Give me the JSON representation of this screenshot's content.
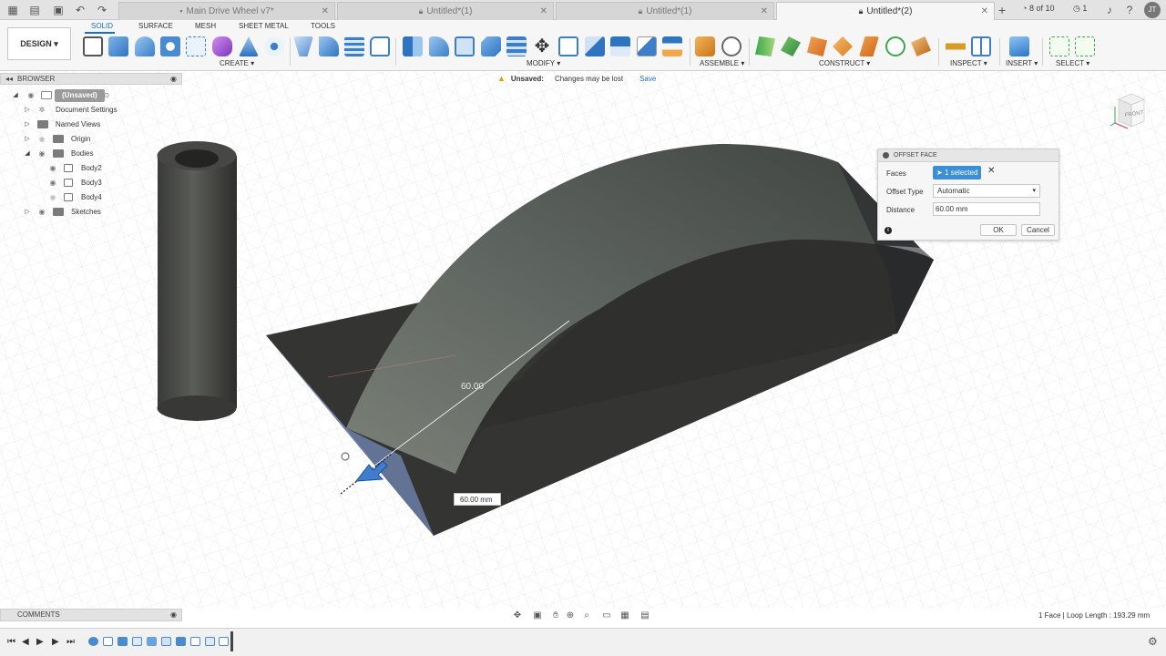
{
  "tabs": [
    {
      "label": "Main Drive Wheel v7*",
      "active": false
    },
    {
      "label": "Untitled*(1)",
      "active": false
    },
    {
      "label": "Untitled*(1)",
      "active": false
    },
    {
      "label": "Untitled*(2)",
      "active": true
    }
  ],
  "topbar": {
    "job_status": "8 of 10",
    "notifications": "1",
    "user_initials": "JT"
  },
  "ribbon": {
    "workspace": "DESIGN ▾",
    "tabs": [
      "SOLID",
      "SURFACE",
      "MESH",
      "SHEET METAL",
      "TOOLS"
    ],
    "groups": [
      "CREATE ▾",
      "MODIFY ▾",
      "ASSEMBLE ▾",
      "CONSTRUCT ▾",
      "INSPECT ▾",
      "INSERT ▾",
      "SELECT ▾"
    ]
  },
  "browser": {
    "title": "BROWSER",
    "items": [
      {
        "label": "(Unsaved)"
      },
      {
        "label": "Document Settings"
      },
      {
        "label": "Named Views"
      },
      {
        "label": "Origin"
      },
      {
        "label": "Bodies"
      },
      {
        "label": "Body2"
      },
      {
        "label": "Body3"
      },
      {
        "label": "Body4"
      },
      {
        "label": "Sketches"
      }
    ]
  },
  "banner": {
    "title": "Unsaved:",
    "message": "Changes may be lost",
    "action": "Save"
  },
  "viewcube": {
    "face": "FRONT"
  },
  "dialog": {
    "title": "OFFSET FACE",
    "faces_label": "Faces",
    "faces_value": "1 selected",
    "offset_type_label": "Offset Type",
    "offset_type_value": "Automatic",
    "distance_label": "Distance",
    "distance_value": "60.00 mm",
    "ok": "OK",
    "cancel": "Cancel"
  },
  "canvas": {
    "dimension_label": "60.00",
    "input_value": "60.00 mm"
  },
  "comments": {
    "title": "COMMENTS"
  },
  "status": {
    "text": "1 Face | Loop Length : 193.29 mm"
  },
  "colors": {
    "accent": "#1a6fc4",
    "selection": "#3a8fd6",
    "background": "#ffffff"
  }
}
